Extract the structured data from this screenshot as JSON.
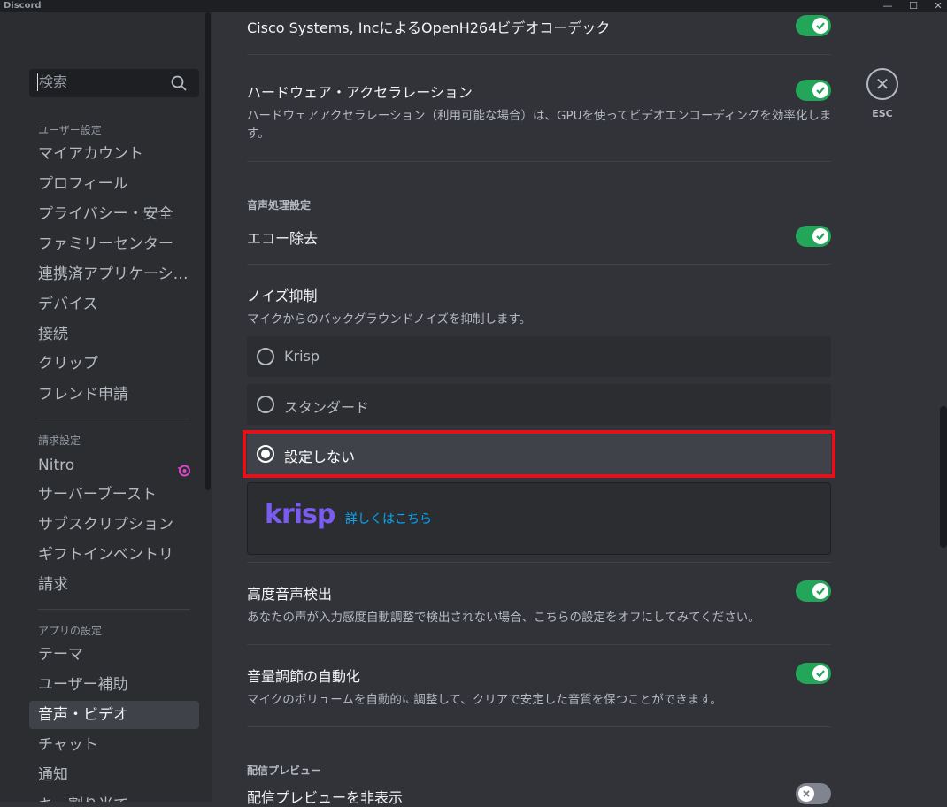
{
  "window": {
    "app_name": "Discord",
    "minimize": "—",
    "maximize": "☐",
    "close": "✕"
  },
  "sidebar": {
    "search_placeholder": "検索",
    "categories": [
      "ユーザー設定",
      "請求設定",
      "アプリの設定"
    ],
    "user_settings": [
      "マイアカウント",
      "プロフィール",
      "プライバシー・安全",
      "ファミリーセンター",
      "連携済アプリケーショ...",
      "デバイス",
      "接続",
      "クリップ",
      "フレンド申請"
    ],
    "billing_settings": [
      "Nitro",
      "サーバーブースト",
      "サブスクリプション",
      "ギフトインベントリ",
      "請求"
    ],
    "app_settings": [
      "テーマ",
      "ユーザー補助",
      "音声・ビデオ",
      "チャット",
      "通知",
      "キー割り当て"
    ],
    "selected": "音声・ビデオ"
  },
  "main": {
    "openh264": {
      "title": "Cisco Systems, IncによるOpenH264ビデオコーデック",
      "enabled": true
    },
    "hw_accel": {
      "title": "ハードウェア・アクセラレーション",
      "desc": "ハードウェアアクセラレーション（利用可能な場合）は、GPUを使ってビデオエンコーディングを効率化します。",
      "enabled": true
    },
    "audio_heading": "音声処理設定",
    "echo": {
      "title": "エコー除去",
      "enabled": true
    },
    "noise": {
      "title": "ノイズ抑制",
      "desc": "マイクからのバックグラウンドノイズを抑制します。",
      "options": [
        "Krisp",
        "スタンダード",
        "設定しない"
      ],
      "selected": "設定しない"
    },
    "krisp": {
      "logo": "krisp",
      "link": "詳しくはこちら"
    },
    "advanced_voice": {
      "title": "高度音声検出",
      "desc": "あなたの声が入力感度自動調整で検出されない場合、こちらの設定をオフにしてみてください。",
      "enabled": true
    },
    "auto_gain": {
      "title": "音量調節の自動化",
      "desc": "マイクのボリュームを自動的に調整して、クリアで安定した音質を保つことができます。",
      "enabled": true
    },
    "stream_heading": "配信プレビュー",
    "stream_preview": {
      "title": "配信プレビューを非表示",
      "enabled": false
    },
    "esc_label": "ESC",
    "esc_icon": "✕"
  },
  "colors": {
    "accent_green": "#23a55a",
    "highlight_red": "#e0121c",
    "link_blue": "#00a8fc",
    "krisp_purple": "#7b5cf0"
  }
}
